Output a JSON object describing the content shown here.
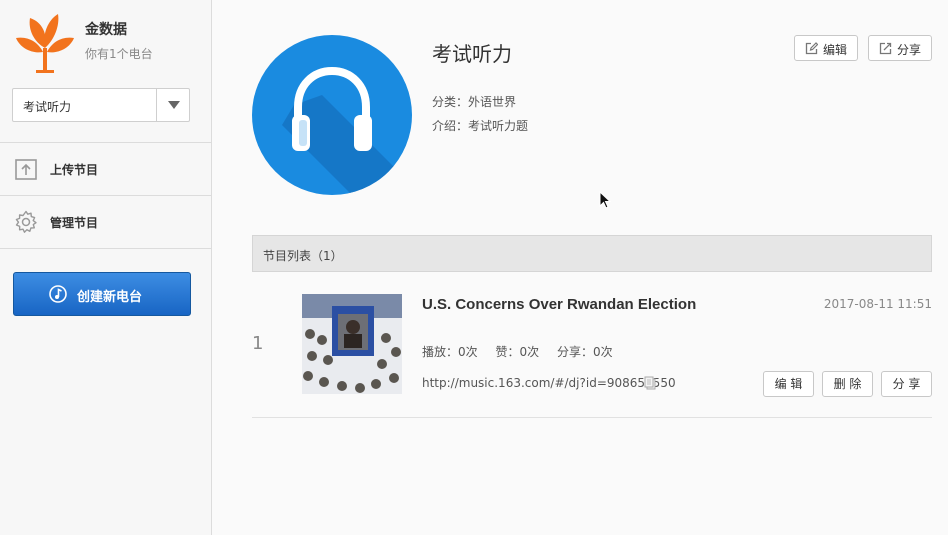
{
  "user": {
    "name": "金数据",
    "subtitle": "你有1个电台"
  },
  "radio_select": {
    "value": "考试听力"
  },
  "nav": {
    "upload_label": "上传节目",
    "manage_label": "管理节目"
  },
  "create_button": {
    "label": "创建新电台"
  },
  "radio": {
    "title": "考试听力",
    "category_line": "分类：外语世界",
    "intro_line": "介绍：考试听力题",
    "edit_label": "编辑",
    "share_label": "分享"
  },
  "program_list": {
    "header": "节目列表（1）",
    "items": [
      {
        "index": "1",
        "title": "U.S. Concerns Over Rwandan Election",
        "date": "2017-08-11 11:51",
        "plays": "播放：0次",
        "likes": "赞：0次",
        "shares": "分享：0次",
        "url": "http://music.163.com/#/dj?id=908653550",
        "edit_label": "编 辑",
        "delete_label": "删 除",
        "share_label": "分 享"
      }
    ]
  },
  "colors": {
    "brand_orange": "#f2731d",
    "cover_blue": "#1a8be0",
    "button_blue": "#2a7bd6"
  },
  "icons": [
    "logo-tree-icon",
    "chevron-down-icon",
    "upload-icon",
    "gear-icon",
    "music-note-icon",
    "headphones-icon",
    "edit-icon",
    "share-icon",
    "copy-icon",
    "cursor-icon"
  ]
}
